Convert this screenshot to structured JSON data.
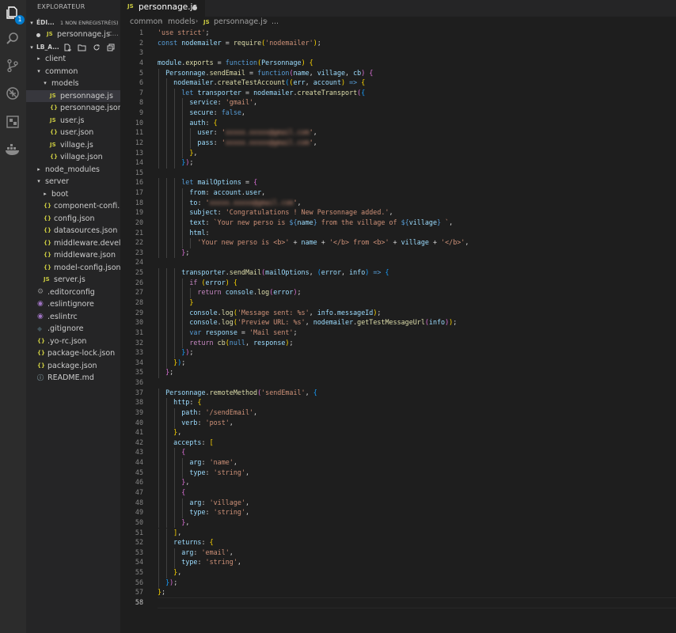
{
  "sidebar": {
    "title": "EXPLORATEUR",
    "open_editors_label": "ÉDI...",
    "unsaved_label": "1 NON ENREGISTRÉ(S)",
    "open_file": "personnage.js",
    "open_file_path": "c...",
    "project_label": "LB_A...",
    "tree": [
      {
        "label": "client",
        "indent": 1,
        "kind": "folder",
        "open": false
      },
      {
        "label": "common",
        "indent": 1,
        "kind": "folder",
        "open": true
      },
      {
        "label": "models",
        "indent": 2,
        "kind": "folder",
        "open": true
      },
      {
        "label": "personnage.js",
        "indent": 3,
        "kind": "js",
        "active": true
      },
      {
        "label": "personnage.json",
        "indent": 3,
        "kind": "json"
      },
      {
        "label": "user.js",
        "indent": 3,
        "kind": "js"
      },
      {
        "label": "user.json",
        "indent": 3,
        "kind": "json"
      },
      {
        "label": "village.js",
        "indent": 3,
        "kind": "js"
      },
      {
        "label": "village.json",
        "indent": 3,
        "kind": "json"
      },
      {
        "label": "node_modules",
        "indent": 1,
        "kind": "folder",
        "open": false
      },
      {
        "label": "server",
        "indent": 1,
        "kind": "folder",
        "open": true
      },
      {
        "label": "boot",
        "indent": 2,
        "kind": "folder",
        "open": false
      },
      {
        "label": "component-confi...",
        "indent": 2,
        "kind": "json"
      },
      {
        "label": "config.json",
        "indent": 2,
        "kind": "json"
      },
      {
        "label": "datasources.json",
        "indent": 2,
        "kind": "json"
      },
      {
        "label": "middleware.devel...",
        "indent": 2,
        "kind": "json"
      },
      {
        "label": "middleware.json",
        "indent": 2,
        "kind": "json"
      },
      {
        "label": "model-config.json",
        "indent": 2,
        "kind": "json"
      },
      {
        "label": "server.js",
        "indent": 2,
        "kind": "js"
      },
      {
        "label": ".editorconfig",
        "indent": 1,
        "kind": "gear"
      },
      {
        "label": ".eslintignore",
        "indent": 1,
        "kind": "eslint"
      },
      {
        "label": ".eslintrc",
        "indent": 1,
        "kind": "eslint"
      },
      {
        "label": ".gitignore",
        "indent": 1,
        "kind": "git"
      },
      {
        "label": ".yo-rc.json",
        "indent": 1,
        "kind": "json"
      },
      {
        "label": "package-lock.json",
        "indent": 1,
        "kind": "json"
      },
      {
        "label": "package.json",
        "indent": 1,
        "kind": "json"
      },
      {
        "label": "README.md",
        "indent": 1,
        "kind": "info"
      }
    ]
  },
  "activity_bar": {
    "icons": [
      "files-icon",
      "search-icon",
      "source-control-icon",
      "debug-icon",
      "extensions-icon",
      "docker-icon"
    ],
    "badge": "1"
  },
  "tab": {
    "label": "personnage.js",
    "icon": "JS"
  },
  "breadcrumb": [
    "common",
    "models",
    "personnage.js",
    "..."
  ],
  "file_icon_labels": {
    "js": "JS",
    "json": "{}"
  },
  "editor": {
    "current_line": 58,
    "lines": [
      "'use strict';",
      "const nodemailer = require('nodemailer');",
      "",
      "module.exports = function(Personnage) {",
      "  Personnage.sendEmail = function(name, village, cb) {",
      "    nodemailer.createTestAccount((err, account) => {",
      "      let transporter = nodemailer.createTransport({",
      "        service: 'gmail',",
      "        secure: false,",
      "        auth: {",
      "          user: '[redacted]',",
      "          pass: '[redacted]',",
      "        },",
      "      });",
      "",
      "      let mailOptions = {",
      "        from: account.user,",
      "        to: '[redacted]',",
      "        subject: 'Congratulations ! New Personnage added.',",
      "        text: `Your new perso is ${name} from the village of ${village} `,",
      "        html:",
      "          'Your new perso is <b>' + name + '</b> from <b>' + village + '</b>',",
      "      };",
      "",
      "      transporter.sendMail(mailOptions, (error, info) => {",
      "        if (error) {",
      "          return console.log(error);",
      "        }",
      "        console.log('Message sent: %s', info.messageId);",
      "        console.log('Preview URL: %s', nodemailer.getTestMessageUrl(info));",
      "        var response = 'Mail sent';",
      "        return cb(null, response);",
      "      });",
      "    });",
      "  };",
      "",
      "  Personnage.remoteMethod('sendEmail', {",
      "    http: {",
      "      path: '/sendEmail',",
      "      verb: 'post',",
      "    },",
      "    accepts: [",
      "      {",
      "        arg: 'name',",
      "        type: 'string',",
      "      },",
      "      {",
      "        arg: 'village',",
      "        type: 'string',",
      "      },",
      "    ],",
      "    returns: {",
      "      arg: 'email',",
      "      type: 'string',",
      "    },",
      "  });",
      "};",
      ""
    ]
  }
}
